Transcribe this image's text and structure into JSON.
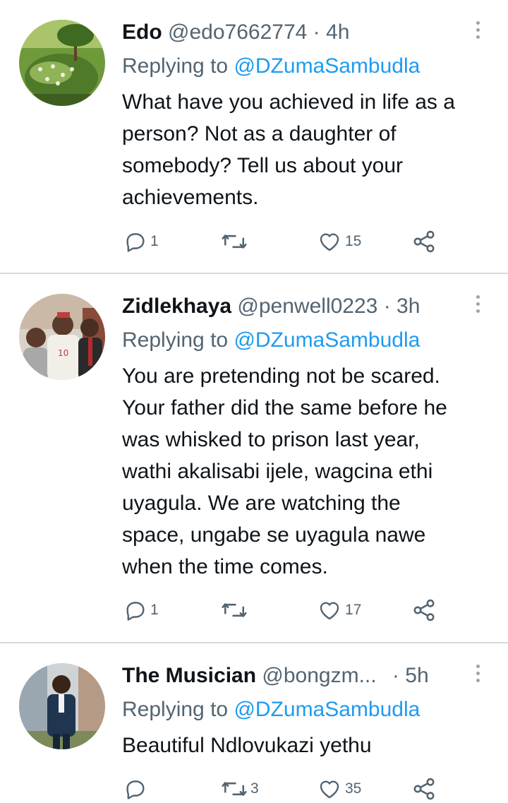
{
  "tweets": [
    {
      "name": "Edo",
      "handle": "@edo7662774",
      "separator": "·",
      "time": "4h",
      "replying_prefix": "Replying to",
      "replying_to": "@DZumaSambudla",
      "text": "What have you achieved in life as a\nperson? Not as a daughter of\nsomebody? Tell us about your\nachievements.",
      "replies": "1",
      "retweets": "",
      "likes": "15"
    },
    {
      "name": "Zidlekhaya",
      "handle": "@penwell0223",
      "separator": "·",
      "time": "3h",
      "replying_prefix": "Replying to",
      "replying_to": "@DZumaSambudla",
      "text": "You are pretending not be scared.\nYour father did the same before he\nwas whisked to prison last year,\nwathi akalisabi ijele, wagcina ethi\nuyagula. We are watching the\nspace, ungabe se uyagula nawe\nwhen the time comes.",
      "replies": "1",
      "retweets": "",
      "likes": "17"
    },
    {
      "name": "The Musician",
      "handle": "@bongzm...",
      "separator": "·",
      "time": "5h",
      "replying_prefix": "Replying to",
      "replying_to": "@DZumaSambudla",
      "text": "Beautiful Ndlovukazi yethu",
      "replies": "",
      "retweets": "3",
      "likes": "35"
    }
  ],
  "colors": {
    "accent": "#1d9bf0",
    "muted": "#536471",
    "text": "#0f1419",
    "divider": "#d4d9de"
  },
  "icons": [
    "reply-icon",
    "retweet-icon",
    "like-icon",
    "share-icon",
    "more-icon"
  ]
}
